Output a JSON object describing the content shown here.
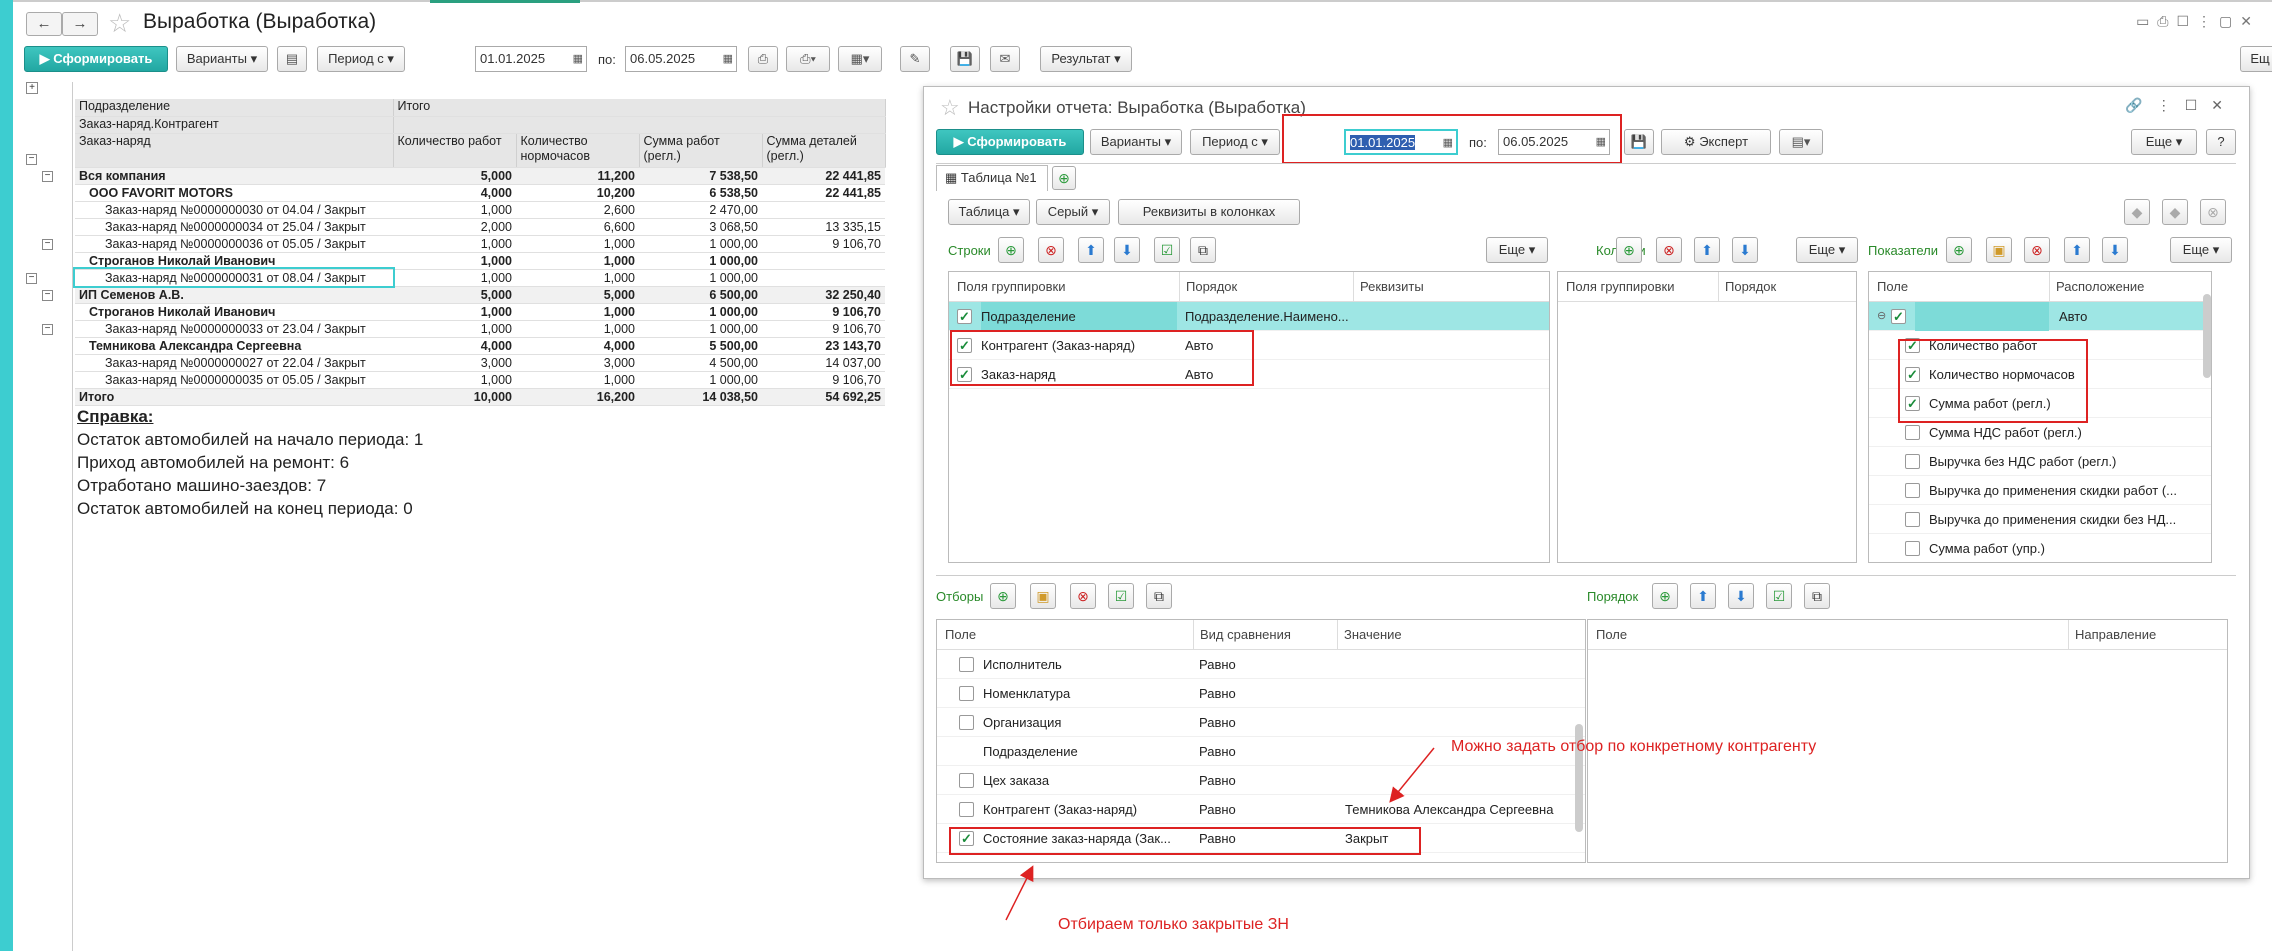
{
  "header": {
    "title": "Выработка (Выработка)",
    "back": "←",
    "forward": "→"
  },
  "toolbar": {
    "generate": "Сформировать",
    "variants": "Варианты",
    "period_from": "Период с",
    "date_from": "01.01.2025",
    "to_label": "по:",
    "date_to": "06.05.2025",
    "result": "Результат",
    "more": "Ещ"
  },
  "report": {
    "headers": [
      "Подразделение",
      "Итого"
    ],
    "header_row2": "Заказ-наряд.Контрагент",
    "header_row3": "Заказ-наряд",
    "columns": [
      "Количество работ",
      "Количество нормочасов",
      "Сумма работ (регл.)",
      "Сумма деталей (регл.)"
    ],
    "rows": [
      {
        "name": "Вся компания",
        "v": [
          "5,000",
          "11,200",
          "7 538,50",
          "22 441,85"
        ],
        "level": 0,
        "bold": true
      },
      {
        "name": "ООО FAVORIT MOTORS",
        "v": [
          "4,000",
          "10,200",
          "6 538,50",
          "22 441,85"
        ],
        "level": 1,
        "bold": true
      },
      {
        "name": "Заказ-наряд №0000000030  от 04.04 / Закрыт",
        "v": [
          "1,000",
          "2,600",
          "2 470,00",
          ""
        ],
        "level": 2,
        "bold": false
      },
      {
        "name": "Заказ-наряд №0000000034  от 25.04 / Закрыт",
        "v": [
          "2,000",
          "6,600",
          "3 068,50",
          "13 335,15"
        ],
        "level": 2,
        "bold": false
      },
      {
        "name": "Заказ-наряд №0000000036  от 05.05 / Закрыт",
        "v": [
          "1,000",
          "1,000",
          "1 000,00",
          "9 106,70"
        ],
        "level": 2,
        "bold": false
      },
      {
        "name": "Строганов Николай Иванович",
        "v": [
          "1,000",
          "1,000",
          "1 000,00",
          ""
        ],
        "level": 1,
        "bold": true
      },
      {
        "name": "Заказ-наряд №0000000031  от 08.04 / Закрыт",
        "v": [
          "1,000",
          "1,000",
          "1 000,00",
          ""
        ],
        "level": 2,
        "bold": false
      },
      {
        "name": "ИП Семенов А.В.",
        "v": [
          "5,000",
          "5,000",
          "6 500,00",
          "32 250,40"
        ],
        "level": 0,
        "bold": true
      },
      {
        "name": "Строганов Николай Иванович",
        "v": [
          "1,000",
          "1,000",
          "1 000,00",
          "9 106,70"
        ],
        "level": 1,
        "bold": true
      },
      {
        "name": "Заказ-наряд №0000000033  от 23.04 / Закрыт",
        "v": [
          "1,000",
          "1,000",
          "1 000,00",
          "9 106,70"
        ],
        "level": 2,
        "bold": false
      },
      {
        "name": "Темникова Александра Сергеевна",
        "v": [
          "4,000",
          "4,000",
          "5 500,00",
          "23 143,70"
        ],
        "level": 1,
        "bold": true
      },
      {
        "name": "Заказ-наряд №0000000027  от 22.04 / Закрыт",
        "v": [
          "3,000",
          "3,000",
          "4 500,00",
          "14 037,00"
        ],
        "level": 2,
        "bold": false
      },
      {
        "name": "Заказ-наряд №0000000035  от 05.05 / Закрыт",
        "v": [
          "1,000",
          "1,000",
          "1 000,00",
          "9 106,70"
        ],
        "level": 2,
        "bold": false
      },
      {
        "name": "Итого",
        "v": [
          "10,000",
          "16,200",
          "14 038,50",
          "54 692,25"
        ],
        "level": 0,
        "bold": true
      }
    ]
  },
  "reference": {
    "title": "Справка:",
    "lines": [
      "Остаток автомобилей на начало периода: 1",
      "Приход автомобилей на ремонт: 6",
      "Отработано машино-заездов: 7",
      "Остаток автомобилей на конец периода: 0"
    ]
  },
  "settings": {
    "title": "Настройки отчета: Выработка (Выработка)",
    "generate": "Сформировать",
    "variants": "Варианты",
    "period_from": "Период с",
    "date_from": "01.01.2025",
    "to_label": "по:",
    "date_to": "06.05.2025",
    "expert": "Эксперт",
    "more": "Еще",
    "help": "?",
    "tab": "Таблица №1",
    "table_btn": "Таблица",
    "gray_btn": "Серый",
    "req_cols": "Реквизиты в колонках",
    "rows_label": "Строки",
    "cols_label": "Колонки",
    "ind_label": "Показатели",
    "more2": "Еще",
    "rows_headers": [
      "Поля группировки",
      "Порядок",
      "Реквизиты"
    ],
    "rows_items": [
      {
        "field": "Подразделение",
        "order": "Подразделение.Наимено...",
        "checked": true
      },
      {
        "field": "Контрагент (Заказ-наряд)",
        "order": "Авто",
        "checked": true
      },
      {
        "field": "Заказ-наряд",
        "order": "Авто",
        "checked": true
      }
    ],
    "cols_headers": [
      "Поля группировки",
      "Порядок"
    ],
    "ind_headers": [
      "Поле",
      "Расположение"
    ],
    "ind_root": "Авто",
    "ind_items": [
      {
        "name": "Количество работ",
        "checked": true
      },
      {
        "name": "Количество нормочасов",
        "checked": true
      },
      {
        "name": "Сумма работ (регл.)",
        "checked": true
      },
      {
        "name": "Сумма НДС работ (регл.)",
        "checked": false
      },
      {
        "name": "Выручка без НДС работ (регл.)",
        "checked": false
      },
      {
        "name": "Выручка до применения скидки работ (...",
        "checked": false
      },
      {
        "name": "Выручка до применения скидки без НД...",
        "checked": false
      },
      {
        "name": "Сумма работ (упр.)",
        "checked": false
      }
    ],
    "filters_label": "Отборы",
    "order_label": "Порядок",
    "filters_headers": [
      "Поле",
      "Вид сравнения",
      "Значение"
    ],
    "filters": [
      {
        "field": "Исполнитель",
        "cmp": "Равно",
        "value": "",
        "cb": true,
        "checked": false
      },
      {
        "field": "Номенклатура",
        "cmp": "Равно",
        "value": "",
        "cb": true,
        "checked": false
      },
      {
        "field": "Организация",
        "cmp": "Равно",
        "value": "",
        "cb": true,
        "checked": false
      },
      {
        "field": "Подразделение",
        "cmp": "Равно",
        "value": "",
        "cb": false,
        "checked": false
      },
      {
        "field": "Цех заказа",
        "cmp": "Равно",
        "value": "",
        "cb": true,
        "checked": false
      },
      {
        "field": "Контрагент (Заказ-наряд)",
        "cmp": "Равно",
        "value": "Темникова Александра Сергеевна",
        "cb": true,
        "checked": false
      },
      {
        "field": "Состояние заказ-наряда (Зак...",
        "cmp": "Равно",
        "value": "Закрыт",
        "cb": true,
        "checked": true
      }
    ],
    "order_headers": [
      "Поле",
      "Направление"
    ]
  },
  "annotations": {
    "a1": "Можно задать отбор по конкретному контрагенту",
    "a2": "Отбираем только закрытые ЗН"
  },
  "colors": {
    "accent": "#3dcdd0",
    "green": "#22a7a2",
    "red": "#d22222"
  }
}
